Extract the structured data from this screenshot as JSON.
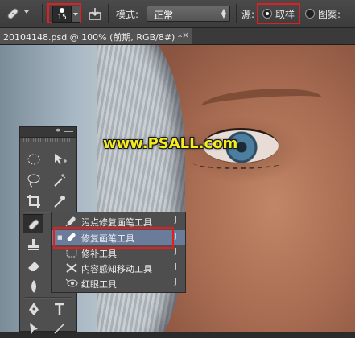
{
  "options_bar": {
    "tool_icon": "healing-brush-icon",
    "brush_size": "15",
    "mode_label": "模式:",
    "mode_value": "正常",
    "source_label": "源:",
    "source_sampled_label": "取样",
    "source_pattern_label": "图案:"
  },
  "document_tab": {
    "title": "20104148.psd @ 100% (前期, RGB/8#) *",
    "close": "×"
  },
  "watermark": "www.PSALL.com",
  "toolbox": {
    "collapse": "◂◂"
  },
  "flyout": {
    "items": [
      {
        "label": "污点修复画笔工具",
        "key": "J",
        "icon": "spot-healing-brush-icon",
        "selected": false,
        "checked": false
      },
      {
        "label": "修复画笔工具",
        "key": "J",
        "icon": "healing-brush-icon",
        "selected": true,
        "checked": true
      },
      {
        "label": "修补工具",
        "key": "J",
        "icon": "patch-tool-icon",
        "selected": false,
        "checked": false
      },
      {
        "label": "内容感知移动工具",
        "key": "J",
        "icon": "content-aware-move-icon",
        "selected": false,
        "checked": false
      },
      {
        "label": "红眼工具",
        "key": "J",
        "icon": "red-eye-icon",
        "selected": false,
        "checked": false
      }
    ],
    "check_mark": "■"
  },
  "colors": {
    "highlight_red": "#e02020",
    "selection_blue": "#6a7c99",
    "watermark_yellow": "#f4ec20"
  }
}
